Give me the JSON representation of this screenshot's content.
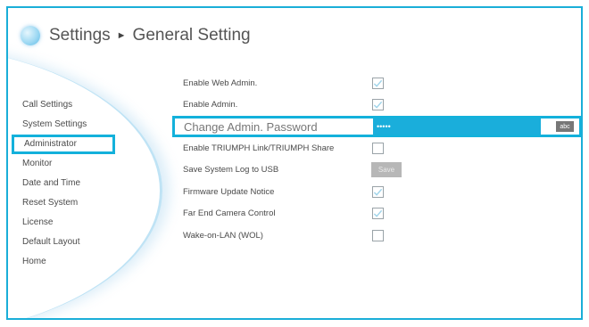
{
  "header": {
    "crumb_root": "Settings",
    "crumb_separator": "►",
    "crumb_current": "General Setting"
  },
  "sidebar": {
    "items": [
      {
        "label": "Call Settings",
        "selected": false
      },
      {
        "label": "System Settings",
        "selected": false
      },
      {
        "label": "Administrator",
        "selected": true
      },
      {
        "label": "Monitor",
        "selected": false
      },
      {
        "label": "Date and Time",
        "selected": false
      },
      {
        "label": "Reset System",
        "selected": false
      },
      {
        "label": "License",
        "selected": false
      },
      {
        "label": "Default Layout",
        "selected": false
      },
      {
        "label": "Home",
        "selected": false
      }
    ]
  },
  "settings": {
    "enable_web_admin": {
      "label": "Enable Web Admin.",
      "checked": true
    },
    "enable_admin": {
      "label": "Enable Admin.",
      "checked": true
    },
    "change_password": {
      "label": "Change Admin. Password",
      "value": "•••••",
      "mode_badge": "abc"
    },
    "enable_link_share": {
      "label": "Enable TRIUMPH Link/TRIUMPH Share",
      "checked": false
    },
    "save_log": {
      "label": "Save System Log to USB",
      "button": "Save"
    },
    "firmware_notice": {
      "label": "Firmware Update Notice",
      "checked": true
    },
    "far_end_camera": {
      "label": "Far End Camera Control",
      "checked": true
    },
    "wake_on_lan": {
      "label": "Wake-on-LAN (WOL)",
      "checked": false
    }
  },
  "colors": {
    "accent": "#13b1db",
    "frame_border": "#1aaed8",
    "checkmark": "#9fd4ea"
  }
}
